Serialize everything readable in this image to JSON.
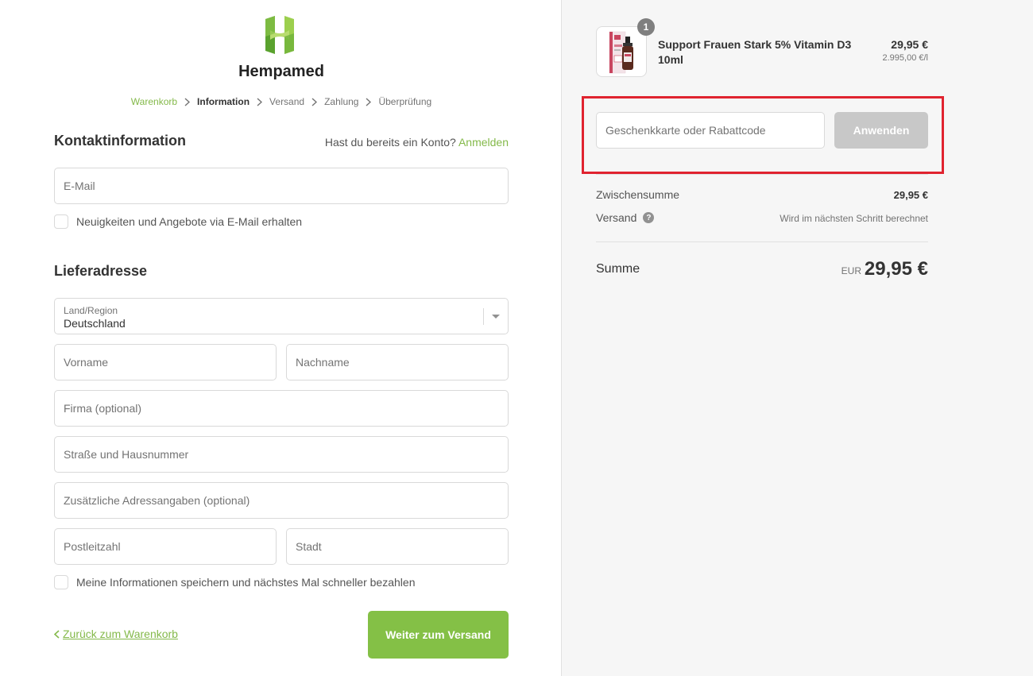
{
  "brand": {
    "name": "Hempamed",
    "logo_colors": [
      "#84c046",
      "#5a9a2b",
      "#b3d96a"
    ]
  },
  "breadcrumb": {
    "items": [
      {
        "label": "Warenkorb",
        "state": "done"
      },
      {
        "label": "Information",
        "state": "current"
      },
      {
        "label": "Versand",
        "state": "upcoming"
      },
      {
        "label": "Zahlung",
        "state": "upcoming"
      },
      {
        "label": "Überprüfung",
        "state": "upcoming"
      }
    ]
  },
  "contact": {
    "title": "Kontaktinformation",
    "login_prompt": "Hast du bereits ein Konto?",
    "login_link": "Anmelden",
    "email_placeholder": "E-Mail",
    "newsletter_label": "Neuigkeiten und Angebote via E-Mail erhalten"
  },
  "shipping": {
    "title": "Lieferadresse",
    "country_label": "Land/Region",
    "country_value": "Deutschland",
    "first_name_placeholder": "Vorname",
    "last_name_placeholder": "Nachname",
    "company_placeholder": "Firma (optional)",
    "street_placeholder": "Straße und Hausnummer",
    "address2_placeholder": "Zusätzliche Adressangaben (optional)",
    "zip_placeholder": "Postleitzahl",
    "city_placeholder": "Stadt",
    "save_info_label": "Meine Informationen speichern und nächstes Mal schneller bezahlen"
  },
  "actions": {
    "back_label": "Zurück zum Warenkorb",
    "continue_label": "Weiter zum Versand"
  },
  "order": {
    "product": {
      "quantity": "1",
      "name": "Support Frauen Stark 5% Vitamin D3 10ml",
      "price": "29,95 €",
      "unit_price": "2.995,00 €/l"
    },
    "discount_placeholder": "Geschenkkarte oder Rabattcode",
    "apply_label": "Anwenden",
    "subtotal_label": "Zwischensumme",
    "subtotal_value": "29,95 €",
    "shipping_label": "Versand",
    "shipping_value": "Wird im nächsten Schritt berechnet",
    "total_label": "Summe",
    "total_currency": "EUR",
    "total_value": "29,95 €"
  },
  "colors": {
    "accent": "#84c046",
    "link": "#84b94a",
    "highlight": "#e0232f",
    "sidebar_bg": "#f6f6f6"
  }
}
